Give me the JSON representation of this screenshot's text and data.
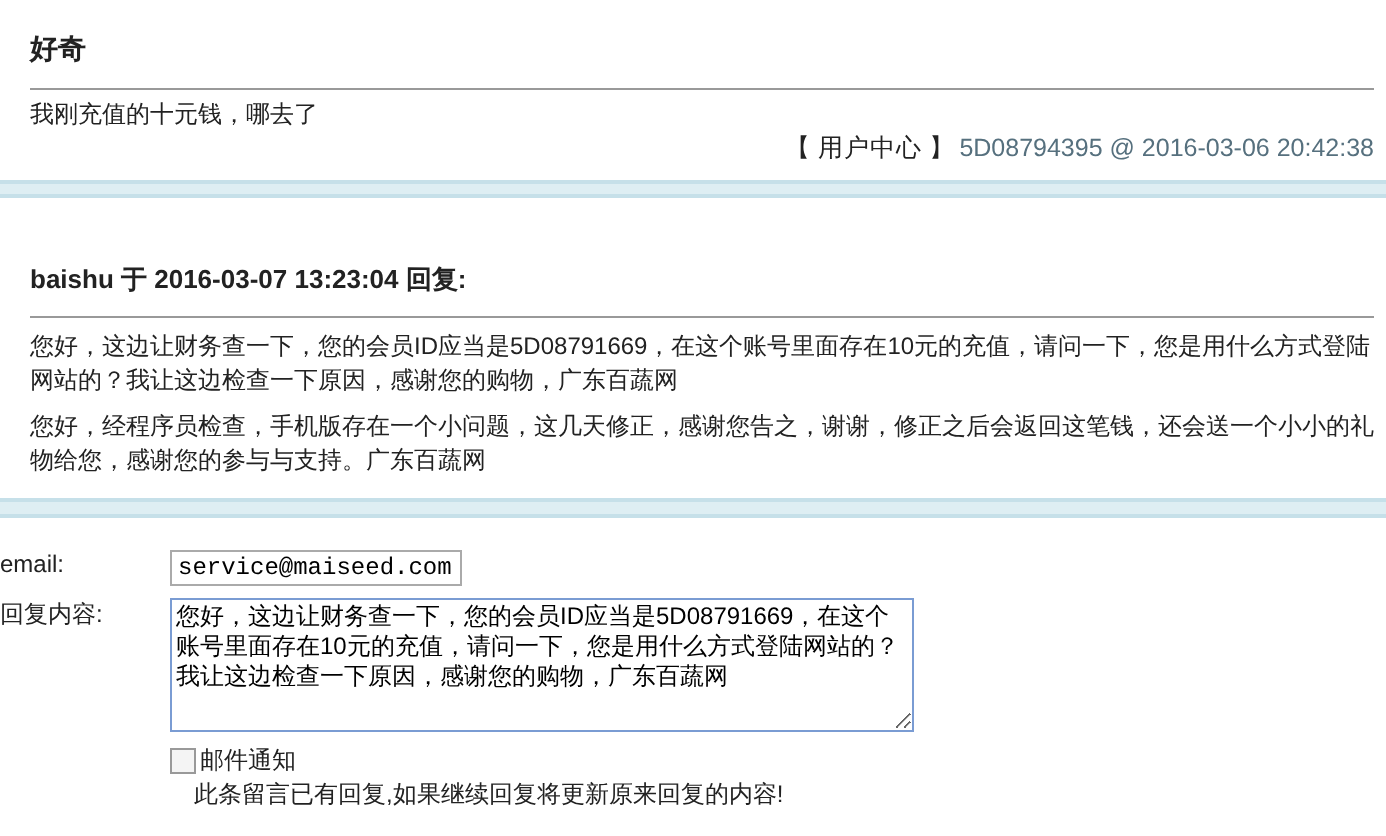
{
  "question": {
    "title": "好奇",
    "content": "我刚充值的十元钱，哪去了",
    "source": "【 用户中心 】",
    "meta": "5D08794395 @ 2016-03-06 20:42:38"
  },
  "reply": {
    "heading": "baishu 于 2016-03-07 13:23:04 回复:",
    "paragraphs": [
      "您好，这边让财务查一下，您的会员ID应当是5D08791669，在这个账号里面存在10元的充值，请问一下，您是用什么方式登陆网站的？我让这边检查一下原因，感谢您的购物，广东百蔬网",
      "您好，经程序员检查，手机版存在一个小问题，这几天修正，感谢您告之，谢谢，修正之后会返回这笔钱，还会送一个小小的礼物给您，感谢您的参与与支持。广东百蔬网"
    ]
  },
  "form": {
    "email_label": "email:",
    "email": "service@maiseed.com",
    "reply_label": "回复内容:",
    "reply_text": "您好，这边让财务查一下，您的会员ID应当是5D08791669，在这个账号里面存在10元的充值，请问一下，您是用什么方式登陆网站的？我让这边检查一下原因，感谢您的购物，广东百蔬网",
    "notify": {
      "label": "邮件通知",
      "checked": false
    },
    "notice": "此条留言已有回复,如果继续回复将更新原来回复的内容!"
  }
}
